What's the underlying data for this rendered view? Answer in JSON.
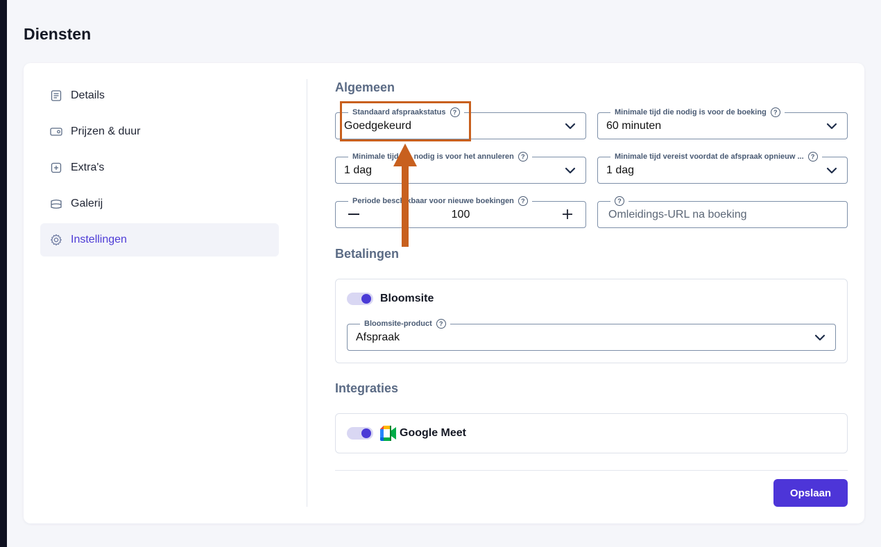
{
  "page": {
    "title": "Diensten"
  },
  "sidebar": {
    "items": [
      {
        "label": "Details",
        "icon": "document-icon"
      },
      {
        "label": "Prijzen & duur",
        "icon": "wallet-icon"
      },
      {
        "label": "Extra's",
        "icon": "plus-box-icon"
      },
      {
        "label": "Galerij",
        "icon": "gallery-icon"
      },
      {
        "label": "Instellingen",
        "icon": "gear-icon",
        "active": true
      }
    ]
  },
  "general": {
    "heading": "Algemeen",
    "default_status": {
      "label": "Standaard afspraakstatus",
      "value": "Goedgekeurd"
    },
    "min_booking_time": {
      "label": "Minimale tijd die nodig is voor de boeking",
      "value": "60 minuten"
    },
    "min_cancel_time": {
      "label": "Minimale tijd die nodig is voor het annuleren",
      "value": "1 dag"
    },
    "min_reschedule_time": {
      "label": "Minimale tijd vereist voordat de afspraak opnieuw ...",
      "value": "1 dag"
    },
    "booking_period": {
      "label": "Periode beschikbaar voor nieuwe boekingen",
      "value": "100",
      "minus": "—",
      "plus": "+"
    },
    "redirect_url": {
      "placeholder": "Omleidings-URL na boeking"
    }
  },
  "payments": {
    "heading": "Betalingen",
    "provider": {
      "name": "Bloomsite",
      "enabled": true
    },
    "product": {
      "label": "Bloomsite-product",
      "value": "Afspraak"
    }
  },
  "integrations": {
    "heading": "Integraties",
    "google_meet": {
      "name": "Google Meet",
      "enabled": true
    }
  },
  "actions": {
    "save_label": "Opslaan"
  },
  "colors": {
    "accent": "#4d35d8",
    "annotation": "#c8601e",
    "active_nav_text": "#4d3bd6"
  }
}
